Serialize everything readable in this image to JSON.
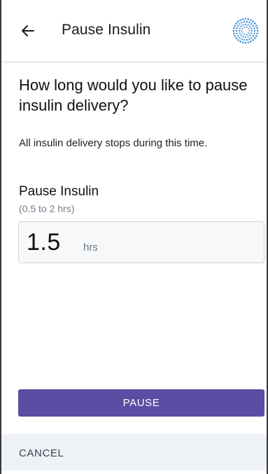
{
  "header": {
    "back_icon": "arrow-left-icon",
    "title": "Pause Insulin",
    "status_icon": "dotted-circle-icon",
    "status_color": "#3b8fd6"
  },
  "main": {
    "question": "How long would you like to pause insulin delivery?",
    "info": "All insulin delivery stops during this time.",
    "field": {
      "label": "Pause Insulin",
      "range": "(0.5 to 2 hrs)",
      "value": "1.5",
      "unit": "hrs"
    }
  },
  "actions": {
    "pause_label": "PAUSE",
    "cancel_label": "CANCEL"
  },
  "colors": {
    "accent": "#5b4da3",
    "cancel_bar": "#eef1f5",
    "hint_text": "#6f7d8a"
  }
}
